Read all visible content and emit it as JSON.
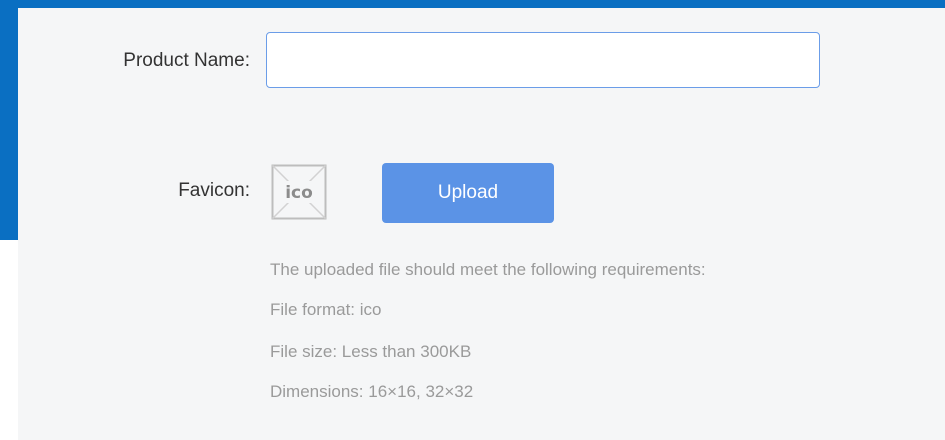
{
  "form": {
    "product_name": {
      "label": "Product Name:",
      "value": "",
      "placeholder": ""
    },
    "favicon": {
      "label": "Favicon:",
      "placeholder_icon": "ico-file-placeholder-icon",
      "placeholder_text": "ico",
      "upload_label": "Upload"
    },
    "requirements": {
      "heading": "The uploaded file should meet the following requirements:",
      "format": "File format: ico",
      "size": "File size: Less than 300KB",
      "dimensions": "Dimensions: 16×16, 32×32"
    }
  },
  "colors": {
    "header_blue": "#0a6fc2",
    "panel_bg": "#f5f6f7",
    "input_border": "#6b9de8",
    "upload_button": "#5b93e6",
    "hint_text": "#9a9a9a"
  }
}
